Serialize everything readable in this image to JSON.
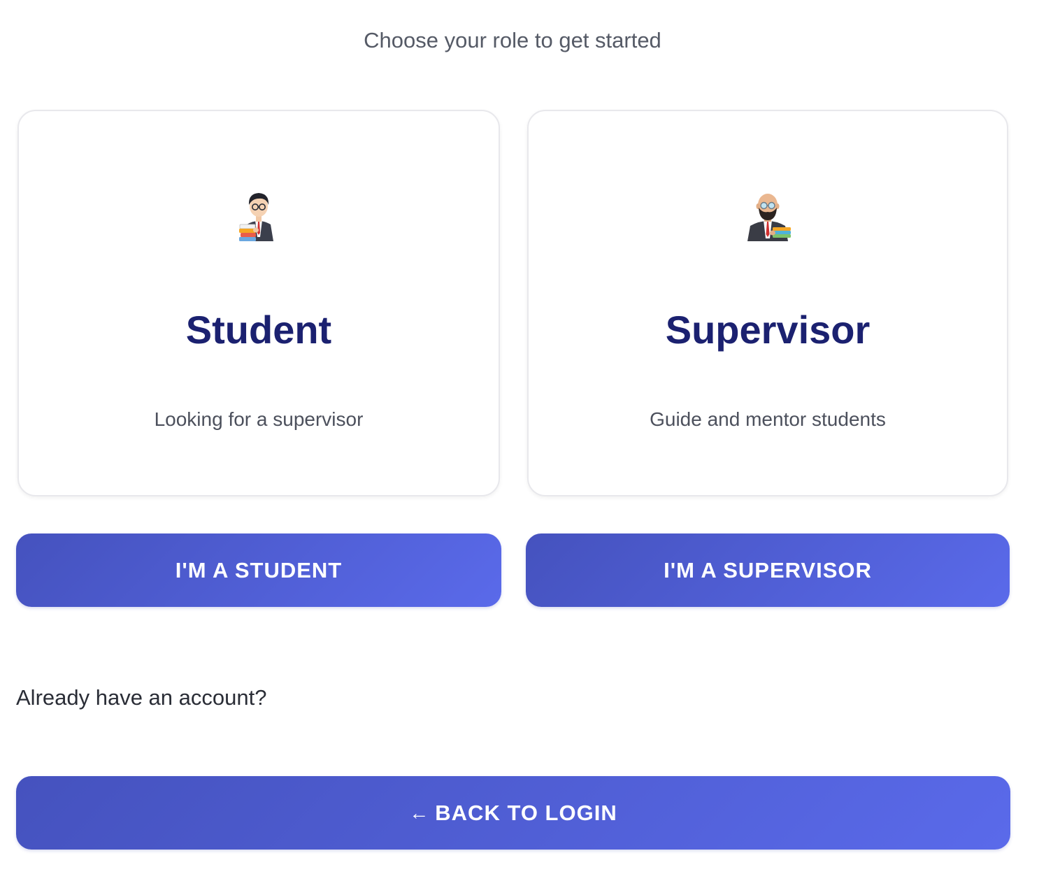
{
  "subtitle": "Choose your role to get started",
  "roles": [
    {
      "title": "Student",
      "description": "Looking for a supervisor",
      "icon": "student-avatar-icon",
      "button_label": "I'M A STUDENT"
    },
    {
      "title": "Supervisor",
      "description": "Guide and mentor students",
      "icon": "supervisor-avatar-icon",
      "button_label": "I'M A SUPERVISOR"
    }
  ],
  "login": {
    "prompt": "Already have an account?",
    "back_icon": "arrow-left-icon",
    "back_arrow": "←",
    "back_label": "BACK TO LOGIN"
  },
  "colors": {
    "title": "#1b2170",
    "button_start": "#4552be",
    "button_end": "#5a6aea"
  }
}
